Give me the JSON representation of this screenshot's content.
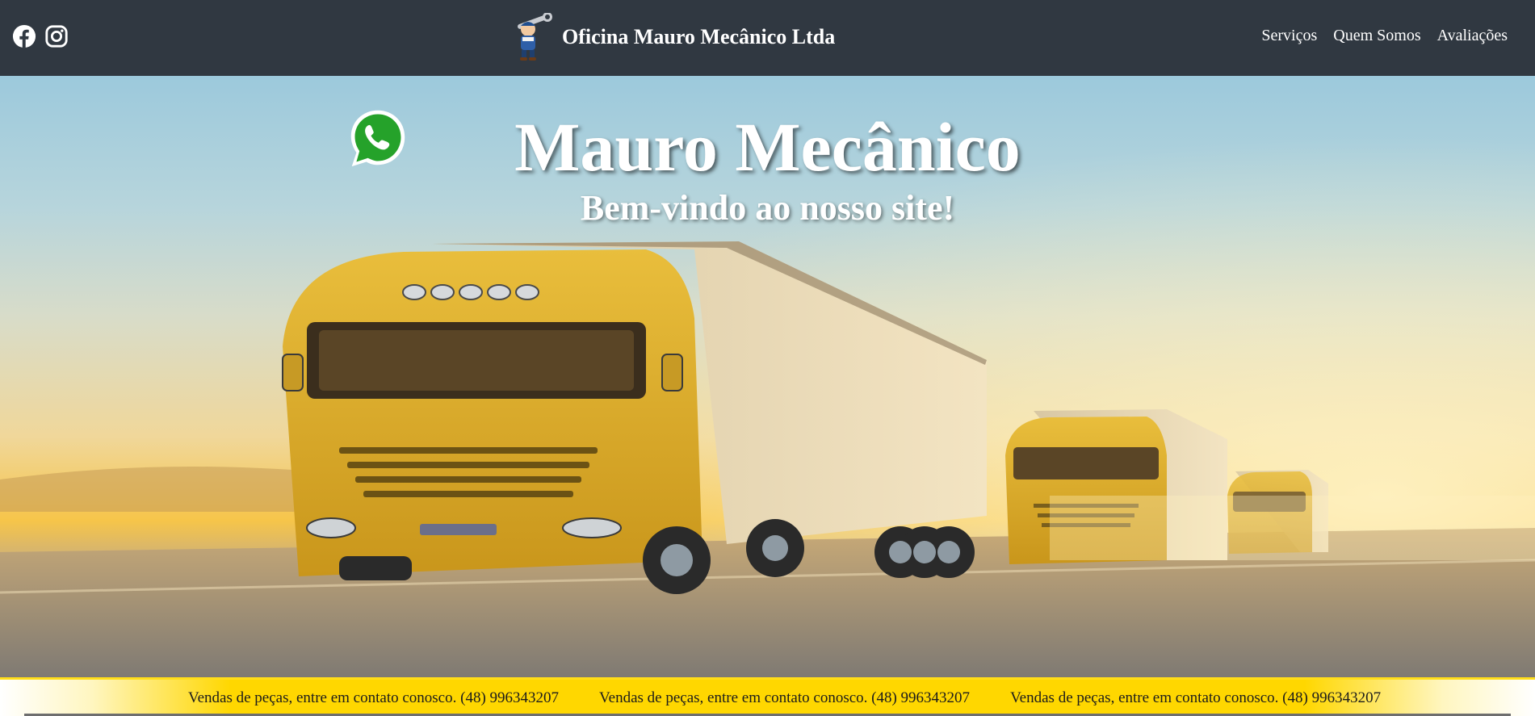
{
  "header": {
    "site_title": "Oficina Mauro Mecânico Ltda",
    "social_icons": [
      "facebook-icon",
      "instagram-icon"
    ],
    "nav": [
      {
        "label": "Serviços"
      },
      {
        "label": "Quem Somos"
      },
      {
        "label": "Avaliações"
      }
    ]
  },
  "hero": {
    "title": "Mauro Mecânico",
    "subtitle": "Bem-vindo ao nosso site!",
    "whatsapp_icon": "whatsapp-icon"
  },
  "ticker": {
    "items": [
      "Vendas de peças, entre em contato conosco. (48) 996343207",
      "Vendas de peças, entre em contato conosco. (48) 996343207",
      "Vendas de peças, entre em contato conosco. (48) 996343207"
    ]
  },
  "colors": {
    "header_bg": "#303841",
    "ticker_bg": "#ffd700",
    "truck_yellow": "#e8b82a",
    "whatsapp_green": "#25a22a"
  }
}
